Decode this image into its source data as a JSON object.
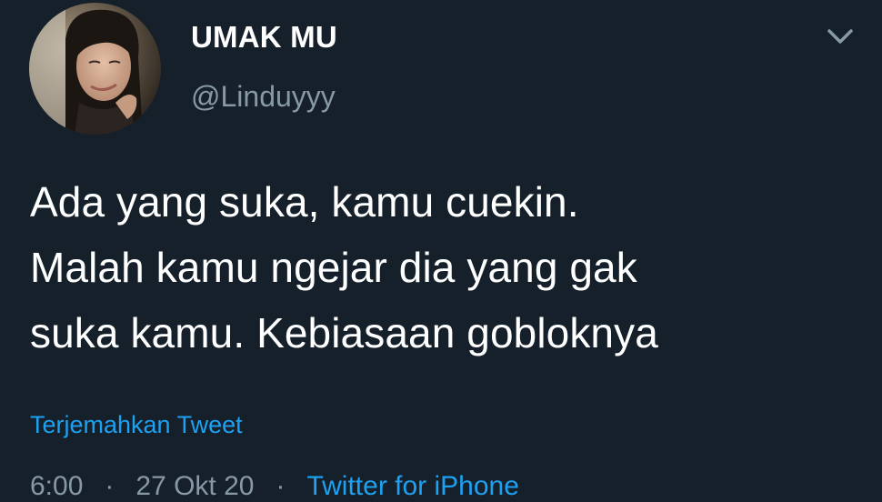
{
  "user": {
    "display_name": "UMAK MU",
    "handle": "@Linduyyy",
    "avatar_icon": "profile-photo"
  },
  "tweet": {
    "text": "Ada yang suka, kamu cuekin.\nMalah kamu ngejar dia yang gak\nsuka kamu. Kebiasaan gobloknya",
    "translate_label": "Terjemahkan Tweet",
    "time": "6:00",
    "date": "27 Okt 20",
    "separator": "·",
    "source": "Twitter for iPhone"
  },
  "icons": {
    "menu": "chevron-down-icon"
  },
  "colors": {
    "background": "#15202b",
    "accent": "#1da1f2",
    "secondary_text": "#8899a6",
    "primary_text": "#ffffff"
  }
}
